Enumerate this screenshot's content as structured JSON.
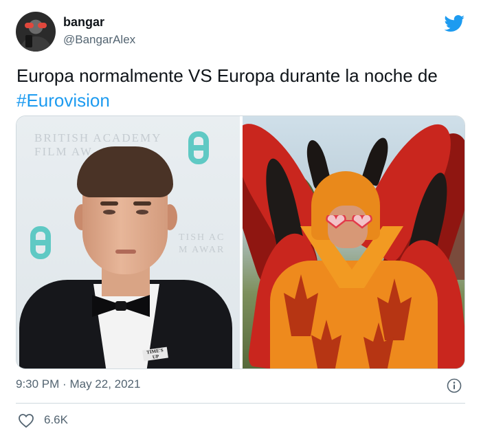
{
  "author": {
    "display_name": "bangar",
    "handle": "@BangarAlex",
    "avatar_icon": "profile-photo"
  },
  "tweet": {
    "text_before": "Europa normalmente VS Europa durante la noche de ",
    "hashtag": "#Eurovision"
  },
  "media": {
    "left": {
      "backdrop_text": [
        "BRITISH ACADEMY",
        "FILM AW"
      ],
      "backdrop_text_right": [
        "TISH AC",
        "M AWAR"
      ],
      "pin_text": [
        "TIME'S",
        "UP"
      ]
    }
  },
  "footer": {
    "time": "9:30 PM",
    "separator": "·",
    "date": "May 22, 2021",
    "likes": "6.6K"
  },
  "colors": {
    "accent": "#1d9bf0",
    "secondary_text": "#536471",
    "border": "#cfd9de"
  },
  "icons": {
    "brand": "twitter-bird-icon",
    "info": "info-icon",
    "like": "heart-icon"
  }
}
